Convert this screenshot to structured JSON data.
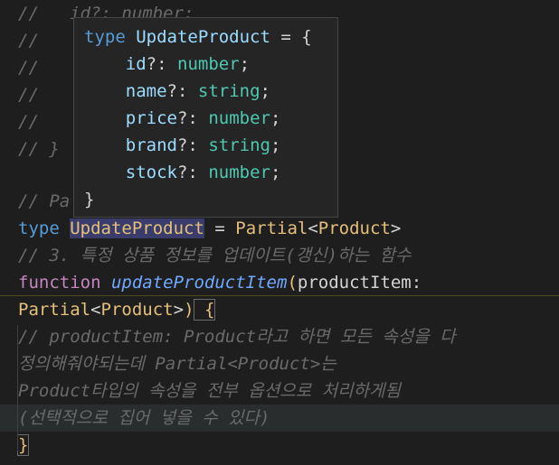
{
  "editor": {
    "lines": [
      {
        "text": "//   id?: number;"
      },
      {
        "text": "//"
      },
      {
        "text": "//"
      },
      {
        "text": "//"
      },
      {
        "text": "//"
      },
      {
        "text": "// }"
      },
      {
        "text": ""
      },
      {
        "text": "// Pa"
      },
      {
        "kw": "type",
        "name": "UpdateProduct",
        "eq": " = ",
        "generic": "Partial",
        "lt": "<",
        "arg": "Product",
        "gt": ">"
      },
      {
        "text": "// 3. 특정 상품 정보를 업데이트(갱신)하는 함수"
      },
      {
        "kw": "function",
        "fn": "updateProductItem",
        "open": "(",
        "param": "productItem:"
      },
      {
        "type": "Partial",
        "lt": "<",
        "arg": "Product",
        "gt": ">",
        "close": ")",
        "brace": " {"
      },
      {
        "text": "// productItem: Product라고 하면 모든 속성을 다"
      },
      {
        "text": "정의해줘야되는데 Partial<Product>는"
      },
      {
        "text": "Product타입의 속성을 전부 옵션으로 처리하게됨"
      },
      {
        "text": "(선택적으로 집어 넣을 수 있다)"
      },
      {
        "text": "}"
      }
    ]
  },
  "hover": {
    "kw": "type",
    "name": "UpdateProduct",
    "open": " = {",
    "fields": [
      {
        "name": "id",
        "opt": "?:",
        "type": "number"
      },
      {
        "name": "name",
        "opt": "?:",
        "type": "string"
      },
      {
        "name": "price",
        "opt": "?:",
        "type": "number"
      },
      {
        "name": "brand",
        "opt": "?:",
        "type": "string"
      },
      {
        "name": "stock",
        "opt": "?:",
        "type": "number"
      }
    ],
    "close": "}"
  }
}
